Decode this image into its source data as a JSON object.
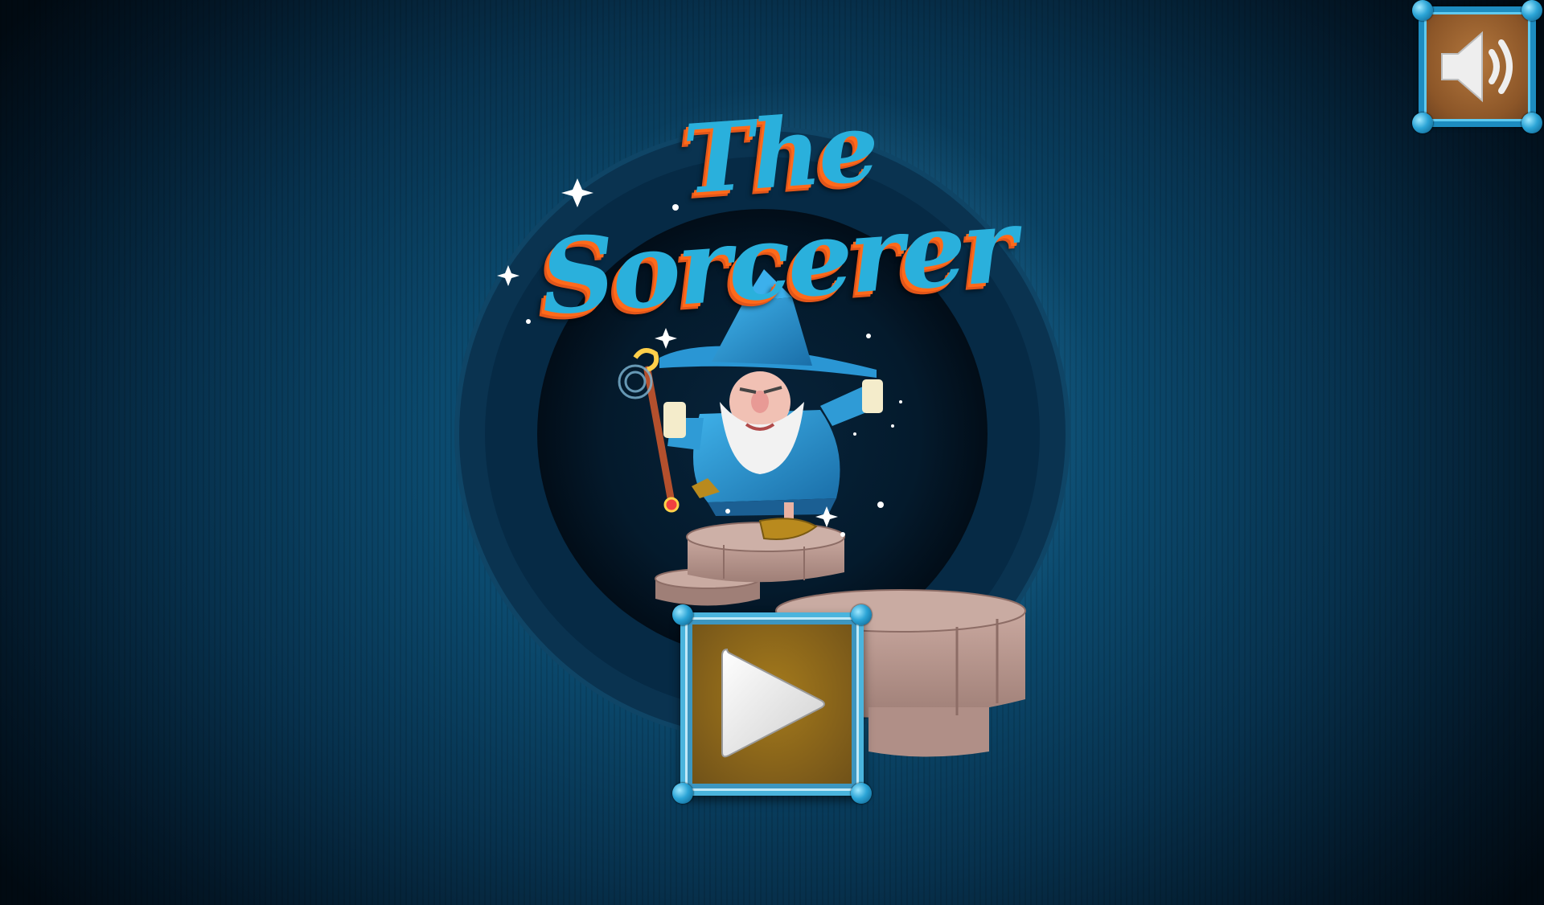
{
  "game": {
    "title_line1": "The",
    "title_line2": "Sorcerer"
  },
  "buttons": {
    "play_icon": "play-icon",
    "sound_icon": "speaker-icon"
  },
  "colors": {
    "title_fill": "#2ab0dc",
    "title_outline": "#ff6a1a",
    "frame_blue": "#1d8cc0",
    "play_panel": "#86621a",
    "sound_panel": "#8c5628"
  }
}
